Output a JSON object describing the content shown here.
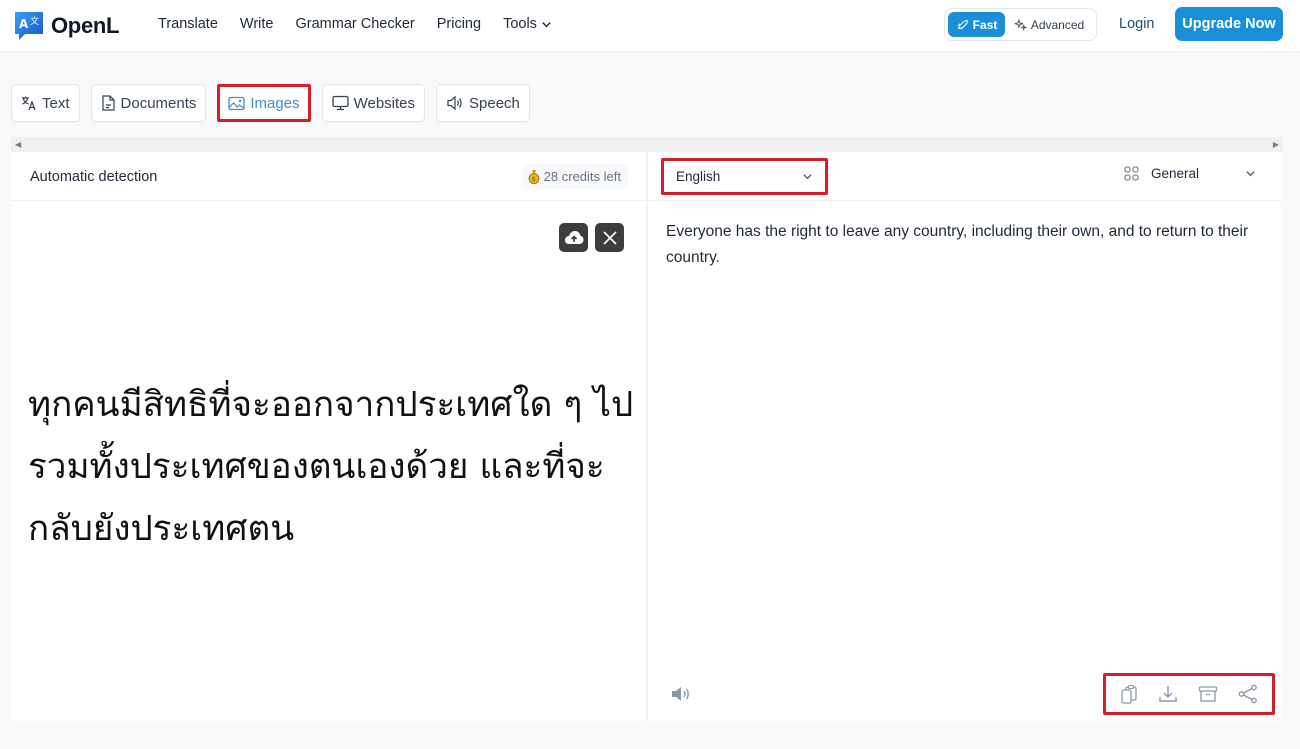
{
  "header": {
    "brand": "OpenL",
    "nav": [
      "Translate",
      "Write",
      "Grammar Checker",
      "Pricing",
      "Tools"
    ],
    "mode": {
      "fast_label": "Fast",
      "advanced_label": "Advanced",
      "selected": "Fast"
    },
    "login_label": "Login",
    "upgrade_label": "Upgrade Now",
    "accent_color": "#1a8fd8"
  },
  "tabs": [
    {
      "label": "Text",
      "icon": "translate-icon"
    },
    {
      "label": "Documents",
      "icon": "document-icon"
    },
    {
      "label": "Images",
      "icon": "image-icon",
      "active": true
    },
    {
      "label": "Websites",
      "icon": "monitor-icon"
    },
    {
      "label": "Speech",
      "icon": "speaker-icon"
    }
  ],
  "source": {
    "language_label": "Automatic detection",
    "credits_label": "28 credits left",
    "text": "ทุกคนมีสิทธิที่จะออกจากประเทศใด ๆ ไป รวมทั้งประเทศของตนเองด้วย และที่จะกลับยังประเทศตน",
    "lines": [
      "ทุกคนมีสิทธิที่จะออกจากประเทศใด ๆ ไป",
      "รวมทั้งประเทศของตนเองด้วย และที่จะ",
      "กลับยังประเทศตน"
    ]
  },
  "target": {
    "language": "English",
    "domain": "General",
    "text": "Everyone has the right to leave any country, including their own, and to return to their country."
  },
  "highlight_color": "#d41f2a"
}
